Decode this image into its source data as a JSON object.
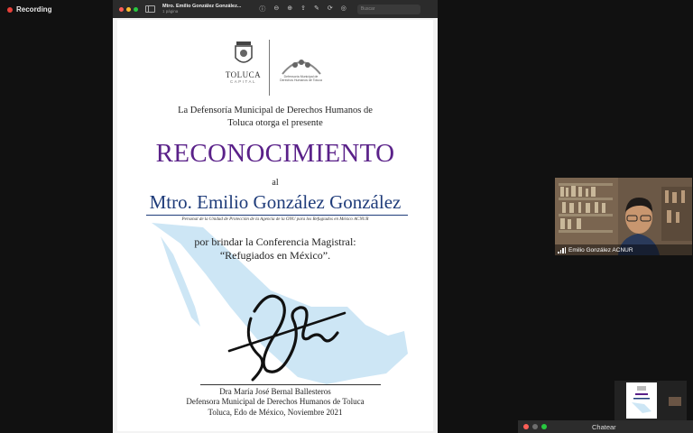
{
  "recording": {
    "label": "Recording",
    "color": "#e8413a"
  },
  "viewer": {
    "title": "Mtro. Emilio González González...",
    "subtitle": "1 página",
    "search_placeholder": "Buscar",
    "window_controls": [
      "#ff5f57",
      "#febc2e",
      "#28c840"
    ]
  },
  "certificate": {
    "logo_left": {
      "name": "TOLUCA",
      "sub": "CAPITAL"
    },
    "logo_right": {
      "text_line1": "Defensoría Municipal de",
      "text_line2": "Derechos Humanos de Toluca"
    },
    "intro_line1": "La Defensoría Municipal de Derechos Humanos de",
    "intro_line2": "Toluca otorga el presente",
    "title": "RECONOCIMIENTO",
    "al": "al",
    "recipient": "Mtro. Emilio González González",
    "position": "Personal de la Unidad de Protección de la Agencia de la ONU para los Refugiados en México ACNUR",
    "reason_line1": "por brindar la Conferencia Magistral:",
    "reason_line2": "“Refugiados en México”.",
    "signer_name": "Dra María José Bernal Ballesteros",
    "signer_title": "Defensora Municipal de Derechos Humanos de Toluca",
    "place_date": "Toluca, Edo de México, Noviembre 2021",
    "title_color": "#5a2189",
    "name_color": "#1f3c7a"
  },
  "participant": {
    "name": "Emilio González ACNUR"
  },
  "chat": {
    "label": "Chatear",
    "window_controls": [
      "#ff5f57",
      "#6e6e6e",
      "#28c840"
    ]
  }
}
